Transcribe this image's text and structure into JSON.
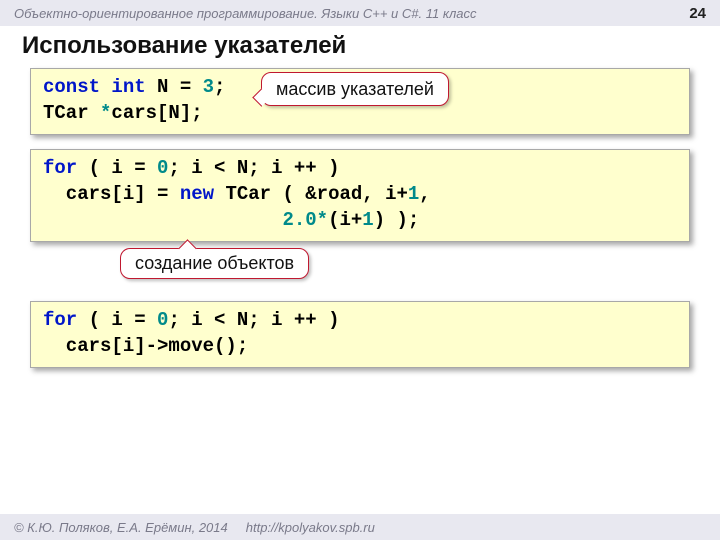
{
  "header": {
    "course": "Объектно-ориентированное программирование. Языки C++ и C#. 11 класс",
    "page": "24"
  },
  "title": "Использование указателей",
  "code1": {
    "l1a": "const",
    "l1b": " int",
    "l1c": " N = ",
    "l1d": "3",
    "l1e": ";",
    "l2a": "TCar ",
    "l2b": "*",
    "l2c": "cars[N];"
  },
  "callout1": "массив указателей",
  "code2": {
    "l1a": "for",
    "l1b": " ( i = ",
    "l1c": "0",
    "l1d": "; i < N; i ++ )",
    "l2a": "  cars[i] = ",
    "l2b": "new",
    "l2c": " TCar ( &road, i+",
    "l2d": "1",
    "l2e": ",",
    "l3a": "                     ",
    "l3b": "2.0",
    "l3c": "*",
    "l3d": "(i+",
    "l3e": "1",
    "l3f": ") );"
  },
  "callout2": "создание объектов",
  "code3": {
    "l1a": "for",
    "l1b": " ( i = ",
    "l1c": "0",
    "l1d": "; i < N; i ++ )",
    "l2": "  cars[i]->move();"
  },
  "footer": {
    "authors": "© К.Ю. Поляков, Е.А. Ерёмин, 2014",
    "url": "http://kpolyakov.spb.ru"
  }
}
